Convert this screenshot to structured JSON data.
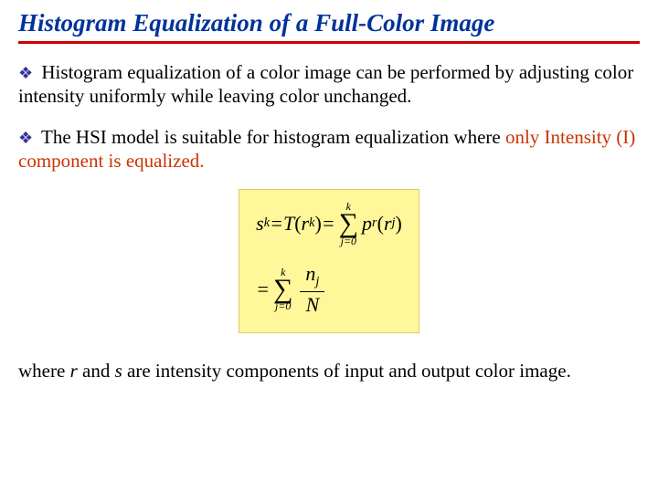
{
  "title": "Histogram Equalization of a Full-Color Image",
  "bullet_glyph": "❖",
  "para1": "Histogram equalization of a color image can be performed by adjusting color intensity uniformly while leaving color unchanged.",
  "para2a": "The HSI model is suitable for histogram equalization where ",
  "para2b": "only Intensity (I) component is equalized.",
  "formula": {
    "lhs_s": "s",
    "lhs_k": "k",
    "eq": " = ",
    "T": "T",
    "lp": "(",
    "r": "r",
    "rp": ")",
    "sum_top": "k",
    "sum_sym": "∑",
    "sum_bot1": "j=0",
    "p": "p",
    "p_sub": "r",
    "rj": "r",
    "j": "j",
    "n": "n",
    "N": "N"
  },
  "footer_a": "where ",
  "footer_r": "r",
  "footer_mid": " and ",
  "footer_s": "s",
  "footer_b": " are intensity components of input and output color image."
}
